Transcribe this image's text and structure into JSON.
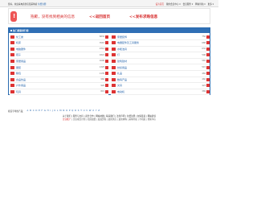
{
  "topbar": {
    "greeting": "您好，欢迎来电商供应链采购商",
    "login": "免费注册",
    "home": "设为首页",
    "menus": [
      "我的会员中心 ▾",
      "会员服务 ▾",
      "网站导航 ▾",
      "更多 ▾"
    ]
  },
  "hero": {
    "message": "抱歉，没有找到相关的信息",
    "back_home": "<<返回首页",
    "publish": "<<发布求购信息"
  },
  "panel": {
    "title": "热门搜索排行榜",
    "left": [
      {
        "label": "化工类",
        "count": "6832"
      },
      {
        "label": "机床",
        "count": "3567"
      },
      {
        "label": "电脑硬件",
        "count": "2314"
      },
      {
        "label": "鞋子",
        "count": "1821"
      },
      {
        "label": "家居用品",
        "count": "1690"
      },
      {
        "label": "服装",
        "count": "1325"
      },
      {
        "label": "箱包",
        "count": "1135"
      },
      {
        "label": "食品饮品",
        "count": "960"
      },
      {
        "label": "户外用品",
        "count": "920"
      },
      {
        "label": "玩具",
        "count": "815"
      }
    ],
    "right": [
      {
        "label": "家居装饰",
        "count": "756"
      },
      {
        "label": "电器配件及工具服务",
        "count": "688"
      },
      {
        "label": "水暖洁具",
        "count": "632"
      },
      {
        "label": "灯",
        "count": "596"
      },
      {
        "label": "建筑建材",
        "count": "565"
      },
      {
        "label": "纺织用品",
        "count": "515"
      },
      {
        "label": "礼品",
        "count": "482"
      },
      {
        "label": "数码产品",
        "count": "460"
      },
      {
        "label": "文具",
        "count": "423"
      },
      {
        "label": "电动机",
        "count": "389"
      }
    ]
  },
  "letters": {
    "prefix": "按首字母找产品：",
    "items": [
      "A",
      "B",
      "C",
      "D",
      "E",
      "F",
      "G",
      "H",
      "I",
      "J",
      "K",
      "L",
      "M",
      "N",
      "O",
      "P",
      "Q",
      "R",
      "S",
      "T",
      "U",
      "V",
      "W",
      "X",
      "Y",
      "Z"
    ]
  },
  "footer": {
    "line1": "关于我们 | 服务与支持 | 商务合作 | 网站地图 | 联系我们 | 法律声明 | 免费注册 | 友情链接 | 网站建议",
    "line2_red": "企业推广",
    "line2": " | 企业成长计划 | 招商加盟 | 发展历程 | 最新供应 | 最新求购 | 采购导航 | 手机版 | 帮助中心"
  },
  "colors": {
    "accent": "#2f6fb5",
    "alert": "#d62b2b",
    "link": "#1e5fa8"
  }
}
